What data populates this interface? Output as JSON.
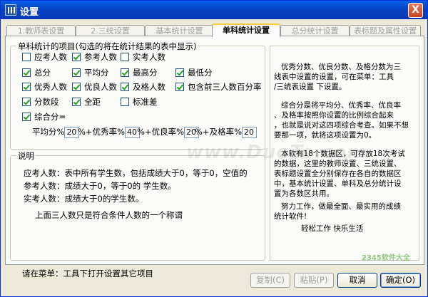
{
  "window": {
    "title": "设置",
    "close_glyph": "X"
  },
  "tabs": [
    {
      "label": "1.教师表设置",
      "active": false
    },
    {
      "label": "2.三统设置",
      "active": false
    },
    {
      "label": "基本统计设置",
      "active": false
    },
    {
      "label": "单科统计设置",
      "active": true
    },
    {
      "label": "总分统计设置",
      "active": false
    },
    {
      "label": "表标题及属性设置",
      "active": false
    }
  ],
  "items_group": {
    "legend": "单科统计的项目(勾选的将在统计结果的表中显示)",
    "checkboxes": [
      {
        "label": "应考人数",
        "checked": false
      },
      {
        "label": "参考人数",
        "checked": true
      },
      {
        "label": "实考人数",
        "checked": false
      },
      {
        "label": "总分",
        "checked": true
      },
      {
        "label": "平均分",
        "checked": true
      },
      {
        "label": "最高分",
        "checked": true
      },
      {
        "label": "最低分",
        "checked": true
      },
      {
        "label": "优秀人数",
        "checked": true
      },
      {
        "label": "优良人数",
        "checked": true
      },
      {
        "label": "及格人数",
        "checked": true
      },
      {
        "label": "包含前三人数百分率",
        "checked": true
      },
      {
        "label": "分数段",
        "checked": true
      },
      {
        "label": "全距",
        "checked": true
      },
      {
        "label": "标准差",
        "checked": false
      },
      {
        "label": "综合分=",
        "checked": true
      }
    ],
    "weights": [
      {
        "label": "平均分%",
        "value": "20"
      },
      {
        "label": "%+优秀率%",
        "value": "40"
      },
      {
        "label": "%+优良率%",
        "value": "20"
      },
      {
        "label": "%+及格率%",
        "value": "20"
      }
    ]
  },
  "notes_group": {
    "legend": "说明",
    "lines": [
      "应考人数：表中所有学生数，包括成绩大于0，等于0，空值的",
      "参考人数：成绩大于0，等于0的 学生数。",
      "实考人数：成绩大于0的学生数。",
      "上面三人数只是符合条件人数的一个称谓"
    ]
  },
  "side_info": {
    "lines": [
      "优秀分数、优良分数、及格分数为三",
      "线表中设置的设置，可在菜单：工具",
      "/三统表设置 下设置。",
      "综合分是将平均分、优秀率、优良率",
      "、及格率按照你设置的比例综合起来",
      "，也就是说对这四项综合考查。如果不想",
      "要那一项，就将这项设置为0。",
      "本软有18个数据区，可存放18次考试",
      "的数据，这里的教师设置、三统设置、",
      "表标题设置全分别保存在各自的数据区",
      "中，基本统计设置、单科及总分统计设",
      "置为各数区共用。",
      "努力工作，做最全面、最实用的成绩",
      "统计软件!",
      "轻松工作  快乐生活"
    ]
  },
  "status_text": "请在菜单：工具下打开设置其它项目",
  "buttons": {
    "copy": "复制(C)",
    "paste": "粘贴(P)",
    "cancel": "取消",
    "ok": "确定(O)"
  },
  "watermarks": {
    "center": "www.DuoTe.com",
    "corner": "2345软件大全"
  }
}
